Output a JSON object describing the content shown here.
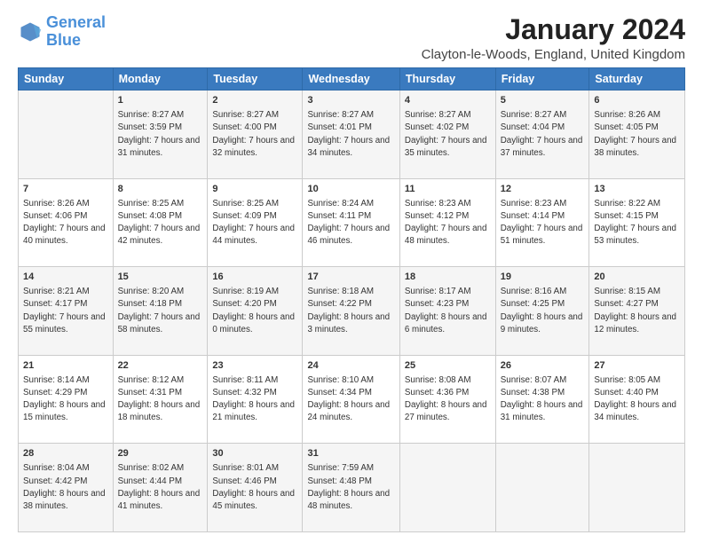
{
  "logo": {
    "line1": "General",
    "line2": "Blue"
  },
  "title": "January 2024",
  "subtitle": "Clayton-le-Woods, England, United Kingdom",
  "days_of_week": [
    "Sunday",
    "Monday",
    "Tuesday",
    "Wednesday",
    "Thursday",
    "Friday",
    "Saturday"
  ],
  "weeks": [
    [
      {
        "num": "",
        "sunrise": "",
        "sunset": "",
        "daylight": ""
      },
      {
        "num": "1",
        "sunrise": "Sunrise: 8:27 AM",
        "sunset": "Sunset: 3:59 PM",
        "daylight": "Daylight: 7 hours and 31 minutes."
      },
      {
        "num": "2",
        "sunrise": "Sunrise: 8:27 AM",
        "sunset": "Sunset: 4:00 PM",
        "daylight": "Daylight: 7 hours and 32 minutes."
      },
      {
        "num": "3",
        "sunrise": "Sunrise: 8:27 AM",
        "sunset": "Sunset: 4:01 PM",
        "daylight": "Daylight: 7 hours and 34 minutes."
      },
      {
        "num": "4",
        "sunrise": "Sunrise: 8:27 AM",
        "sunset": "Sunset: 4:02 PM",
        "daylight": "Daylight: 7 hours and 35 minutes."
      },
      {
        "num": "5",
        "sunrise": "Sunrise: 8:27 AM",
        "sunset": "Sunset: 4:04 PM",
        "daylight": "Daylight: 7 hours and 37 minutes."
      },
      {
        "num": "6",
        "sunrise": "Sunrise: 8:26 AM",
        "sunset": "Sunset: 4:05 PM",
        "daylight": "Daylight: 7 hours and 38 minutes."
      }
    ],
    [
      {
        "num": "7",
        "sunrise": "Sunrise: 8:26 AM",
        "sunset": "Sunset: 4:06 PM",
        "daylight": "Daylight: 7 hours and 40 minutes."
      },
      {
        "num": "8",
        "sunrise": "Sunrise: 8:25 AM",
        "sunset": "Sunset: 4:08 PM",
        "daylight": "Daylight: 7 hours and 42 minutes."
      },
      {
        "num": "9",
        "sunrise": "Sunrise: 8:25 AM",
        "sunset": "Sunset: 4:09 PM",
        "daylight": "Daylight: 7 hours and 44 minutes."
      },
      {
        "num": "10",
        "sunrise": "Sunrise: 8:24 AM",
        "sunset": "Sunset: 4:11 PM",
        "daylight": "Daylight: 7 hours and 46 minutes."
      },
      {
        "num": "11",
        "sunrise": "Sunrise: 8:23 AM",
        "sunset": "Sunset: 4:12 PM",
        "daylight": "Daylight: 7 hours and 48 minutes."
      },
      {
        "num": "12",
        "sunrise": "Sunrise: 8:23 AM",
        "sunset": "Sunset: 4:14 PM",
        "daylight": "Daylight: 7 hours and 51 minutes."
      },
      {
        "num": "13",
        "sunrise": "Sunrise: 8:22 AM",
        "sunset": "Sunset: 4:15 PM",
        "daylight": "Daylight: 7 hours and 53 minutes."
      }
    ],
    [
      {
        "num": "14",
        "sunrise": "Sunrise: 8:21 AM",
        "sunset": "Sunset: 4:17 PM",
        "daylight": "Daylight: 7 hours and 55 minutes."
      },
      {
        "num": "15",
        "sunrise": "Sunrise: 8:20 AM",
        "sunset": "Sunset: 4:18 PM",
        "daylight": "Daylight: 7 hours and 58 minutes."
      },
      {
        "num": "16",
        "sunrise": "Sunrise: 8:19 AM",
        "sunset": "Sunset: 4:20 PM",
        "daylight": "Daylight: 8 hours and 0 minutes."
      },
      {
        "num": "17",
        "sunrise": "Sunrise: 8:18 AM",
        "sunset": "Sunset: 4:22 PM",
        "daylight": "Daylight: 8 hours and 3 minutes."
      },
      {
        "num": "18",
        "sunrise": "Sunrise: 8:17 AM",
        "sunset": "Sunset: 4:23 PM",
        "daylight": "Daylight: 8 hours and 6 minutes."
      },
      {
        "num": "19",
        "sunrise": "Sunrise: 8:16 AM",
        "sunset": "Sunset: 4:25 PM",
        "daylight": "Daylight: 8 hours and 9 minutes."
      },
      {
        "num": "20",
        "sunrise": "Sunrise: 8:15 AM",
        "sunset": "Sunset: 4:27 PM",
        "daylight": "Daylight: 8 hours and 12 minutes."
      }
    ],
    [
      {
        "num": "21",
        "sunrise": "Sunrise: 8:14 AM",
        "sunset": "Sunset: 4:29 PM",
        "daylight": "Daylight: 8 hours and 15 minutes."
      },
      {
        "num": "22",
        "sunrise": "Sunrise: 8:12 AM",
        "sunset": "Sunset: 4:31 PM",
        "daylight": "Daylight: 8 hours and 18 minutes."
      },
      {
        "num": "23",
        "sunrise": "Sunrise: 8:11 AM",
        "sunset": "Sunset: 4:32 PM",
        "daylight": "Daylight: 8 hours and 21 minutes."
      },
      {
        "num": "24",
        "sunrise": "Sunrise: 8:10 AM",
        "sunset": "Sunset: 4:34 PM",
        "daylight": "Daylight: 8 hours and 24 minutes."
      },
      {
        "num": "25",
        "sunrise": "Sunrise: 8:08 AM",
        "sunset": "Sunset: 4:36 PM",
        "daylight": "Daylight: 8 hours and 27 minutes."
      },
      {
        "num": "26",
        "sunrise": "Sunrise: 8:07 AM",
        "sunset": "Sunset: 4:38 PM",
        "daylight": "Daylight: 8 hours and 31 minutes."
      },
      {
        "num": "27",
        "sunrise": "Sunrise: 8:05 AM",
        "sunset": "Sunset: 4:40 PM",
        "daylight": "Daylight: 8 hours and 34 minutes."
      }
    ],
    [
      {
        "num": "28",
        "sunrise": "Sunrise: 8:04 AM",
        "sunset": "Sunset: 4:42 PM",
        "daylight": "Daylight: 8 hours and 38 minutes."
      },
      {
        "num": "29",
        "sunrise": "Sunrise: 8:02 AM",
        "sunset": "Sunset: 4:44 PM",
        "daylight": "Daylight: 8 hours and 41 minutes."
      },
      {
        "num": "30",
        "sunrise": "Sunrise: 8:01 AM",
        "sunset": "Sunset: 4:46 PM",
        "daylight": "Daylight: 8 hours and 45 minutes."
      },
      {
        "num": "31",
        "sunrise": "Sunrise: 7:59 AM",
        "sunset": "Sunset: 4:48 PM",
        "daylight": "Daylight: 8 hours and 48 minutes."
      },
      {
        "num": "",
        "sunrise": "",
        "sunset": "",
        "daylight": ""
      },
      {
        "num": "",
        "sunrise": "",
        "sunset": "",
        "daylight": ""
      },
      {
        "num": "",
        "sunrise": "",
        "sunset": "",
        "daylight": ""
      }
    ]
  ]
}
